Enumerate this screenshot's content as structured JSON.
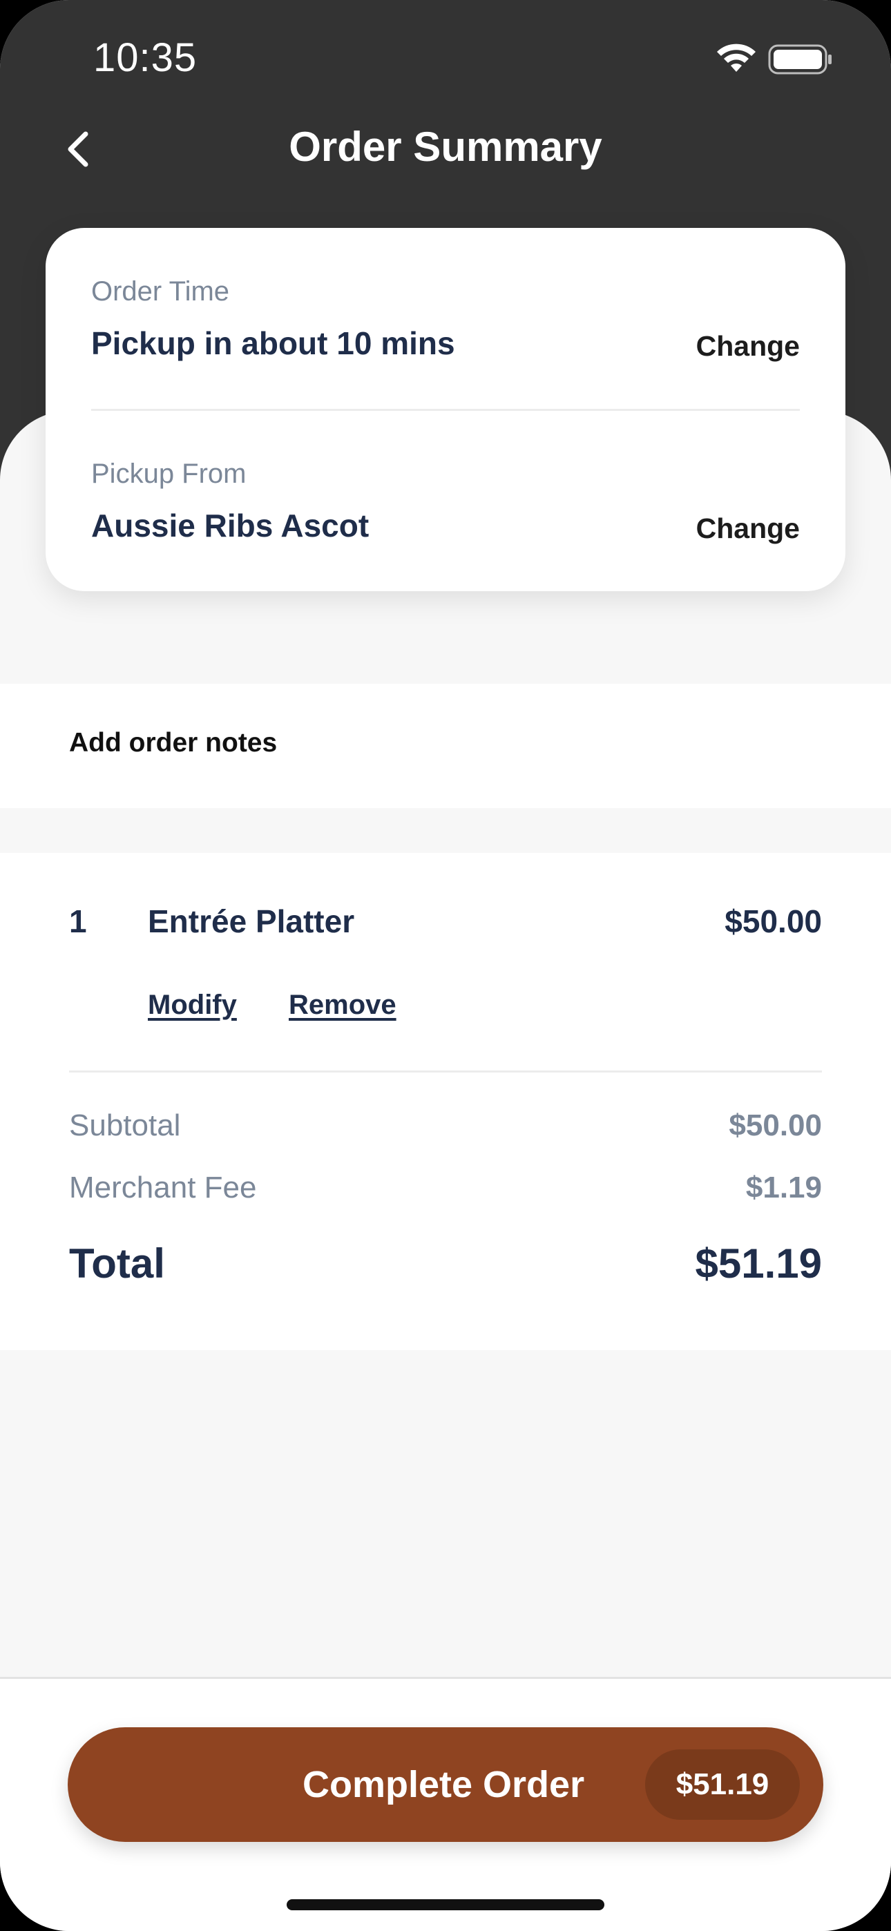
{
  "status_bar": {
    "time": "10:35"
  },
  "header": {
    "title": "Order Summary"
  },
  "order_card": {
    "order_time_label": "Order Time",
    "order_time_value": "Pickup in about 10 mins",
    "order_time_change": "Change",
    "pickup_label": "Pickup From",
    "pickup_value": "Aussie Ribs Ascot",
    "pickup_change": "Change"
  },
  "notes": {
    "label": "Add order notes"
  },
  "items": [
    {
      "qty": "1",
      "name": "Entrée Platter",
      "price": "$50.00",
      "modify": "Modify",
      "remove": "Remove"
    }
  ],
  "summary": {
    "subtotal_label": "Subtotal",
    "subtotal_value": "$50.00",
    "fee_label": "Merchant Fee",
    "fee_value": "$1.19",
    "total_label": "Total",
    "total_value": "$51.19"
  },
  "footer": {
    "button_label": "Complete Order",
    "button_price": "$51.19"
  },
  "colors": {
    "header_bg": "#333333",
    "accent": "#8f4421",
    "text_primary": "#1f2d4a",
    "text_muted": "#7b8798"
  },
  "icons": [
    "wifi-icon",
    "battery-icon",
    "back-chevron-icon"
  ]
}
